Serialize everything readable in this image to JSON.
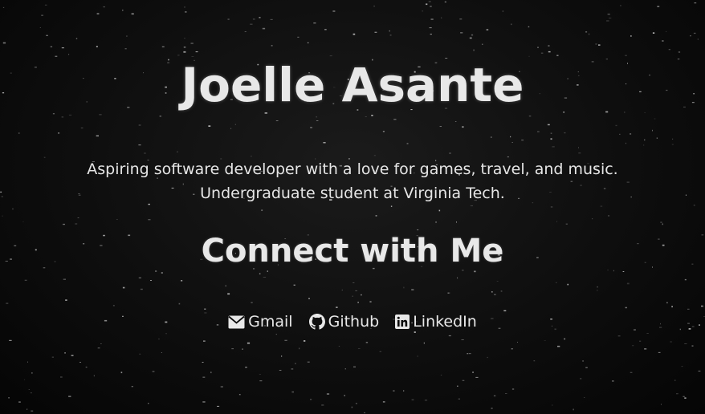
{
  "profile": {
    "name": "Joelle Asante",
    "bio_line1": "Aspiring software developer with a love for games, travel, and music.",
    "bio_line2": "Undergraduate student at Virginia Tech."
  },
  "connect": {
    "heading": "Connect with Me",
    "links": [
      {
        "label": "Gmail",
        "icon": "envelope-icon"
      },
      {
        "label": "Github",
        "icon": "github-icon"
      },
      {
        "label": "LinkedIn",
        "icon": "linkedin-icon"
      }
    ]
  },
  "colors": {
    "background": "#0b0b0b",
    "text": "#e8e8e8"
  }
}
